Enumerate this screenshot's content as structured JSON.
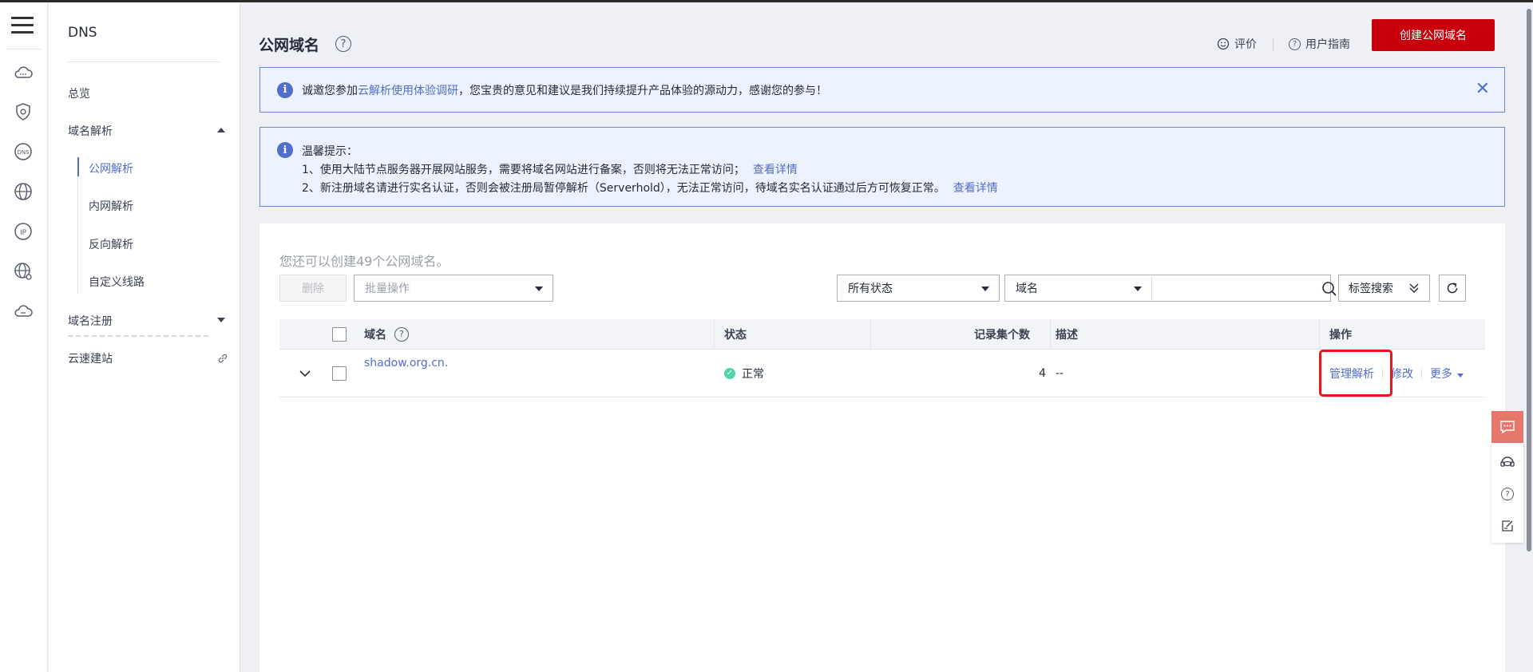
{
  "nav": {
    "title": "DNS",
    "overview": "总览",
    "resolution": "域名解析",
    "public_resolution": "公网解析",
    "private_resolution": "内网解析",
    "reverse_resolution": "反向解析",
    "custom_lines": "自定义线路",
    "registration": "域名注册",
    "site_builder": "云速建站"
  },
  "header": {
    "title": "公网域名",
    "help": "?",
    "feedback": "评价",
    "guide": "用户指南",
    "create_button": "创建公网域名"
  },
  "notice": {
    "prefix": "诚邀您参加",
    "link": "云解析使用体验调研",
    "suffix": "，您宝贵的意见和建议是我们持续提升产品体验的源动力，感谢您的参与！"
  },
  "tips": {
    "title": "温馨提示：",
    "line1": "1、使用大陆节点服务器开展网站服务，需要将域名网站进行备案，否则将无法正常访问；",
    "line1_link": "查看详情",
    "line2": "2、新注册域名请进行实名认证，否则会被注册局暂停解析（Serverhold），无法正常访问，待域名实名认证通过后方可恢复正常。",
    "line2_link": "查看详情"
  },
  "toolbar": {
    "quota_text": "您还可以创建49个公网域名。",
    "delete_button": "删除",
    "bulk_placeholder": "批量操作",
    "status_filter": "所有状态",
    "field_filter": "域名",
    "search_value": "",
    "tag_search": "标签搜索"
  },
  "table": {
    "columns": {
      "domain": "域名",
      "status": "状态",
      "record_count": "记录集个数",
      "description": "描述",
      "operation": "操作"
    },
    "rows": [
      {
        "domain": "shadow.org.cn.",
        "status": "正常",
        "record_count": "4",
        "description": "--",
        "actions": {
          "manage": "管理解析",
          "edit": "修改",
          "more": "更多"
        }
      }
    ]
  },
  "colors": {
    "brand_red": "#c7000b",
    "link_blue": "#526ecc",
    "status_green": "#50d4ab",
    "highlight_red": "#e8141e"
  }
}
